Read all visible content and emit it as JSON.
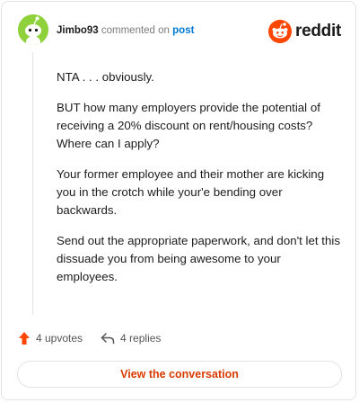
{
  "header": {
    "username": "Jimbo93",
    "action": "commented on",
    "link": "post",
    "brand": "reddit"
  },
  "comment": {
    "paragraphs": [
      "NTA . . . obviously.",
      "BUT how many employers provide the potential of receiving a 20% discount on rent/housing costs? Where can I apply?",
      "Your former employee and their mother are kicking you in the crotch while your'e bending over backwards.",
      "Send out the appropriate paperwork, and don't let this dissuade you from being awesome to your employees."
    ]
  },
  "stats": {
    "upvotes": "4 upvotes",
    "replies": "4 replies"
  },
  "cta": "View the conversation",
  "colors": {
    "avatar_bg": "#8ed13b",
    "link": "#0079d3",
    "reddit_orange": "#ff4500",
    "cta_text": "#d93a00",
    "upvote": "#ff4500"
  },
  "icons": [
    "snoo-avatar-icon",
    "reddit-logo-icon",
    "upvote-arrow-icon",
    "reply-arrow-icon"
  ]
}
